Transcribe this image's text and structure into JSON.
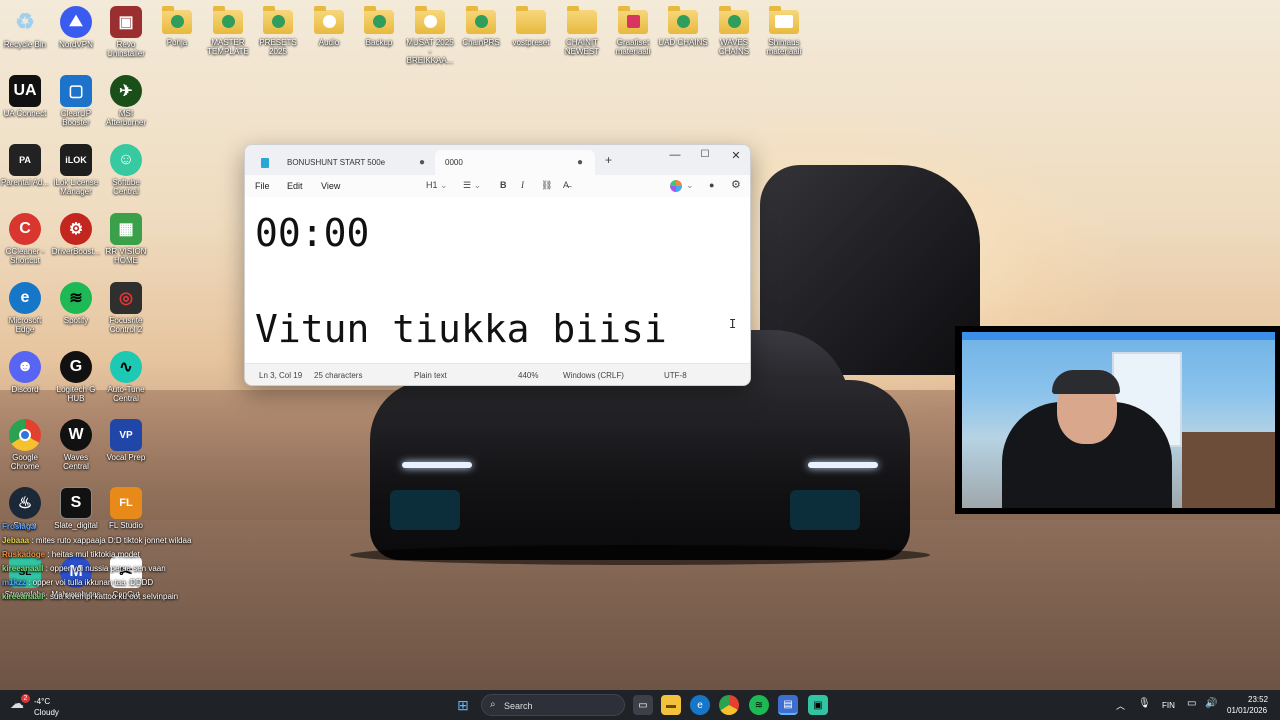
{
  "desktop": {
    "icons_row1": [
      {
        "label": "Recycle Bin"
      },
      {
        "label": "NordVPN"
      },
      {
        "label": "Revo Uninstaller"
      },
      {
        "label": "Pohja"
      },
      {
        "label": "MASTER TEMPLATE"
      },
      {
        "label": "PRESETS 2025"
      },
      {
        "label": "Audio"
      },
      {
        "label": "Backup"
      },
      {
        "label": "MUSAT 2025 - BREIKKAA..."
      },
      {
        "label": "ChainPRS"
      },
      {
        "label": "vostpreset"
      },
      {
        "label": "CHAINIT NEWEST"
      },
      {
        "label": "Graafiset materiaali"
      },
      {
        "label": "UAD CHAINS"
      },
      {
        "label": "WAVES CHAINS"
      },
      {
        "label": "Shimaus materiaali"
      }
    ],
    "icons_col": [
      {
        "label": "UA Connect",
        "glyph": "UA",
        "color": "#111111"
      },
      {
        "label": "ClearUP Booster",
        "glyph": "▢",
        "color": "#1d73c9"
      },
      {
        "label": "MSI Afterburner",
        "glyph": "✈",
        "color": "#1a4f1a"
      },
      {
        "label": "Parental Ad...",
        "glyph": "PA",
        "color": "#222222"
      },
      {
        "label": "iLok License Manager",
        "glyph": "iLOK",
        "color": "#1e1e1e"
      },
      {
        "label": "Softube Central",
        "glyph": "☺",
        "color": "#37c9a0"
      },
      {
        "label": "CCleaner - Shortcut",
        "glyph": "C",
        "color": "#d8362e"
      },
      {
        "label": "DriverBoost...",
        "glyph": "⚙",
        "color": "#c2261e"
      },
      {
        "label": "RR VISION HOME",
        "glyph": "▦",
        "color": "#3aa14a"
      },
      {
        "label": "Microsoft Edge",
        "glyph": "e",
        "color": "#1677c9"
      },
      {
        "label": "Spotify",
        "glyph": "≋",
        "color": "#1db954"
      },
      {
        "label": "Focusrite Control 2",
        "glyph": "◎",
        "color": "#2f2f2f"
      },
      {
        "label": "Discord",
        "glyph": "☻",
        "color": "#5865f2"
      },
      {
        "label": "Logitech G HUB",
        "glyph": "G",
        "color": "#111111"
      },
      {
        "label": "Auto-Tune Central",
        "glyph": "∿",
        "color": "#1ec9b3"
      },
      {
        "label": "Google Chrome",
        "glyph": "◉",
        "color": "#e2412f"
      },
      {
        "label": "Waves Central",
        "glyph": "W",
        "color": "#111111"
      },
      {
        "label": "Vocal Prep",
        "glyph": "VP",
        "color": "#2046a8"
      },
      {
        "label": "Steam",
        "glyph": "♨",
        "color": "#1b2838"
      },
      {
        "label": "Slate_digital",
        "glyph": "S",
        "color": "#111111"
      },
      {
        "label": "FL Studio",
        "glyph": "FL",
        "color": "#e88a1a"
      },
      {
        "label": "Streamlabs",
        "glyph": "SL",
        "color": "#31c3a2"
      },
      {
        "label": "Malwarebytes",
        "glyph": "M",
        "color": "#2a4fc9"
      },
      {
        "label": "CapCut",
        "glyph": "✂",
        "color": "#111111"
      }
    ]
  },
  "notepad": {
    "tab1": "BONUSHUNT START 500e",
    "tab2": "0000",
    "tab_dot": "●",
    "new_tab": "+",
    "minimize": "—",
    "maximize": "☐",
    "close": "✕",
    "menu": {
      "file": "File",
      "edit": "Edit",
      "view": "View"
    },
    "toolbar": {
      "heading": "H1",
      "list": "☰",
      "bold": "B",
      "italic": "I",
      "link": "⛓",
      "clear": "A̶"
    },
    "content_line1": "00:00",
    "content_line3": "Vitun tiukka biisi",
    "status": {
      "position": "Ln 3, Col 19",
      "characters": "25 characters",
      "format": "Plain text",
      "zoom": "440%",
      "line_endings": "Windows (CRLF)",
      "encoding": "UTF-8"
    }
  },
  "chat": [
    {
      "nick": "Froslaga",
      "text": "",
      "color": "#5aa0ff"
    },
    {
      "nick": "Jebaaa",
      "text": ": mites ruto xappaaja D:D tiktok jonnet wildaa",
      "color": "#e5d44a"
    },
    {
      "nick": "Ruskadoge",
      "text": ": heitas mul tiktokia modet",
      "color": "#f08a3a"
    },
    {
      "nick": "kireeanaall",
      "text": ": opper voi nussia peraa sen vaan",
      "color": "#7ee07a"
    },
    {
      "nick": "m1kzz",
      "text": ": opper voi tulla ikkunan taa :DDDD",
      "color": "#5aa0ff"
    },
    {
      "nick": "kireeanaall",
      "text": ": sua kivempi kattoo ku oot selvinpain",
      "color": "#7ee07a"
    }
  ],
  "taskbar": {
    "temp": "-4°C",
    "weather": "Cloudy",
    "weather_badge": "2",
    "search": "Search",
    "lang": "FIN",
    "time": "23:52",
    "date": "01/01/2026"
  }
}
